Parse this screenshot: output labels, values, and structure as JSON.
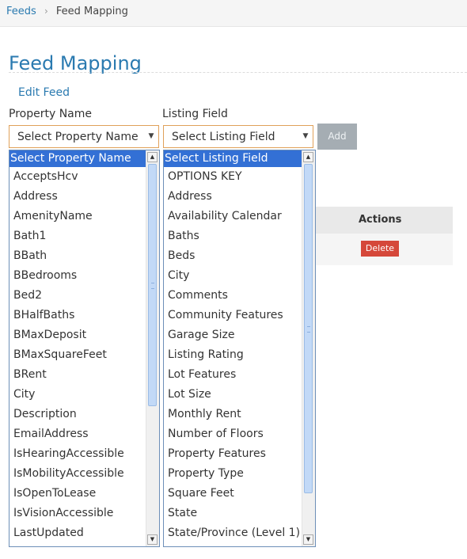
{
  "breadcrumb": {
    "link": "Feeds",
    "separator": "›",
    "current": "Feed Mapping"
  },
  "page": {
    "title": "Feed Mapping",
    "edit_link": "Edit Feed"
  },
  "form": {
    "property_label": "Property Name",
    "listing_label": "Listing Field",
    "property_select_value": "Select Property Name",
    "listing_select_value": "Select Listing Field",
    "add_button": "Add"
  },
  "table": {
    "actions_header": "Actions",
    "delete_button": "Delete"
  },
  "property_options": [
    "Select Property Name",
    "AcceptsHcv",
    "Address",
    "AmenityName",
    "Bath1",
    "BBath",
    "BBedrooms",
    "Bed2",
    "BHalfBaths",
    "BMaxDeposit",
    "BMaxSquareFeet",
    "BRent",
    "City",
    "Description",
    "EmailAddress",
    "IsHearingAccessible",
    "IsMobilityAccessible",
    "IsOpenToLease",
    "IsVisionAccessible",
    "LastUpdated"
  ],
  "listing_options": [
    "Select Listing Field",
    "OPTIONS KEY",
    "Address",
    "Availability Calendar",
    "Baths",
    "Beds",
    "City",
    "Comments",
    "Community Features",
    "Garage Size",
    "Listing Rating",
    "Lot Features",
    "Lot Size",
    "Monthly Rent",
    "Number of Floors",
    "Property Features",
    "Property Type",
    "Square Feet",
    "State",
    "State/Province (Level 1)"
  ],
  "colors": {
    "link": "#2a7ab0",
    "select_focus_border": "#e0a15a",
    "selected_option_bg": "#3370d5",
    "add_button_bg": "#a5adb3",
    "delete_button_bg": "#d5483a"
  },
  "icons": {
    "breadcrumb_separator": "chevron-right-icon",
    "select_arrow": "chevron-down-icon",
    "scroll_up": "arrow-up-icon",
    "scroll_down": "arrow-down-icon"
  }
}
